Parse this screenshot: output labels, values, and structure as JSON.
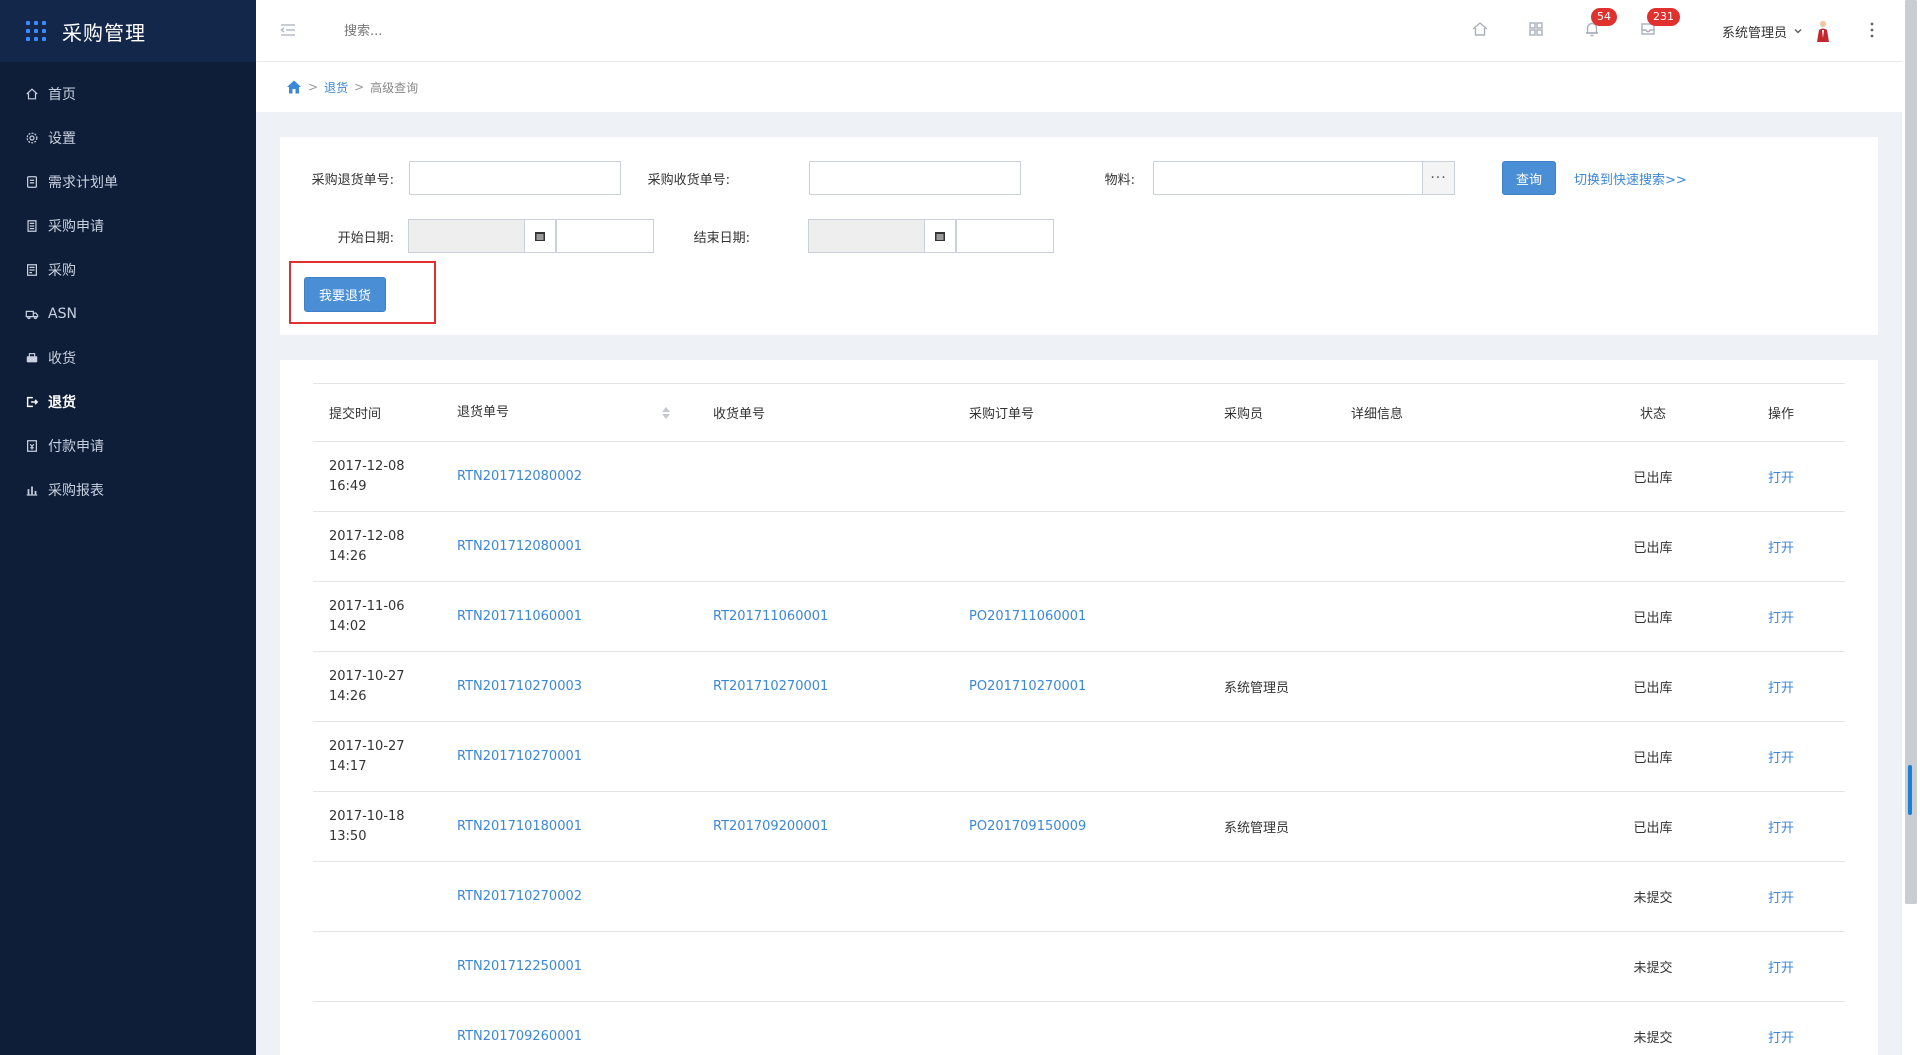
{
  "app": {
    "title": "采购管理"
  },
  "sidebar": {
    "items": [
      {
        "label": "首页",
        "icon": "home-icon"
      },
      {
        "label": "设置",
        "icon": "gear-icon"
      },
      {
        "label": "需求计划单",
        "icon": "clipboard-icon"
      },
      {
        "label": "采购申请",
        "icon": "document-icon"
      },
      {
        "label": "采购",
        "icon": "list-icon"
      },
      {
        "label": "ASN",
        "icon": "truck-icon"
      },
      {
        "label": "收货",
        "icon": "inbox-icon"
      },
      {
        "label": "退货",
        "icon": "return-icon",
        "active": true
      },
      {
        "label": "付款申请",
        "icon": "payment-icon"
      },
      {
        "label": "采购报表",
        "icon": "bar-chart-icon"
      }
    ]
  },
  "topbar": {
    "search_placeholder": "搜索...",
    "notifications_count": "54",
    "messages_count": "231",
    "user_name": "系统管理员"
  },
  "breadcrumb": {
    "section": "退货",
    "current": "高级查询"
  },
  "search_form": {
    "return_no_label": "采购退货单号:",
    "receipt_no_label": "采购收货单号:",
    "material_label": "物料:",
    "material_button": "···",
    "query_button": "查询",
    "switch_link": "切换到快速搜索>>",
    "start_date_label": "开始日期:",
    "end_date_label": "结束日期:",
    "create_return_button": "我要退货"
  },
  "table": {
    "headers": {
      "submit_time": "提交时间",
      "return_no": "退货单号",
      "receipt_no": "收货单号",
      "po_no": "采购订单号",
      "buyer": "采购员",
      "detail": "详细信息",
      "status": "状态",
      "action": "操作"
    },
    "rows": [
      {
        "date": "2017-12-08",
        "time": "16:49",
        "return_no": "RTN201712080002",
        "receipt_no": "",
        "po_no": "",
        "buyer": "",
        "detail": "",
        "status": "已出库",
        "action": "打开"
      },
      {
        "date": "2017-12-08",
        "time": "14:26",
        "return_no": "RTN201712080001",
        "receipt_no": "",
        "po_no": "",
        "buyer": "",
        "detail": "",
        "status": "已出库",
        "action": "打开"
      },
      {
        "date": "2017-11-06",
        "time": "14:02",
        "return_no": "RTN201711060001",
        "receipt_no": "RT201711060001",
        "po_no": "PO201711060001",
        "buyer": "",
        "detail": "",
        "status": "已出库",
        "action": "打开"
      },
      {
        "date": "2017-10-27",
        "time": "14:26",
        "return_no": "RTN201710270003",
        "receipt_no": "RT201710270001",
        "po_no": "PO201710270001",
        "buyer": "系统管理员",
        "detail": "",
        "status": "已出库",
        "action": "打开"
      },
      {
        "date": "2017-10-27",
        "time": "14:17",
        "return_no": "RTN201710270001",
        "receipt_no": "",
        "po_no": "",
        "buyer": "",
        "detail": "",
        "status": "已出库",
        "action": "打开"
      },
      {
        "date": "2017-10-18",
        "time": "13:50",
        "return_no": "RTN201710180001",
        "receipt_no": "RT201709200001",
        "po_no": "PO201709150009",
        "buyer": "系统管理员",
        "detail": "",
        "status": "已出库",
        "action": "打开"
      },
      {
        "date": "",
        "time": "",
        "return_no": "RTN201710270002",
        "receipt_no": "",
        "po_no": "",
        "buyer": "",
        "detail": "",
        "status": "未提交",
        "action": "打开"
      },
      {
        "date": "",
        "time": "",
        "return_no": "RTN201712250001",
        "receipt_no": "",
        "po_no": "",
        "buyer": "",
        "detail": "",
        "status": "未提交",
        "action": "打开"
      },
      {
        "date": "",
        "time": "",
        "return_no": "RTN201709260001",
        "receipt_no": "",
        "po_no": "",
        "buyer": "",
        "detail": "",
        "status": "未提交",
        "action": "打开"
      }
    ]
  },
  "colors": {
    "sidebar_bg": "#0e1d38",
    "accent": "#3b87d8",
    "primary_button": "#4a8ed6",
    "badge": "#e0312f",
    "highlight_box": "#e0312f"
  }
}
